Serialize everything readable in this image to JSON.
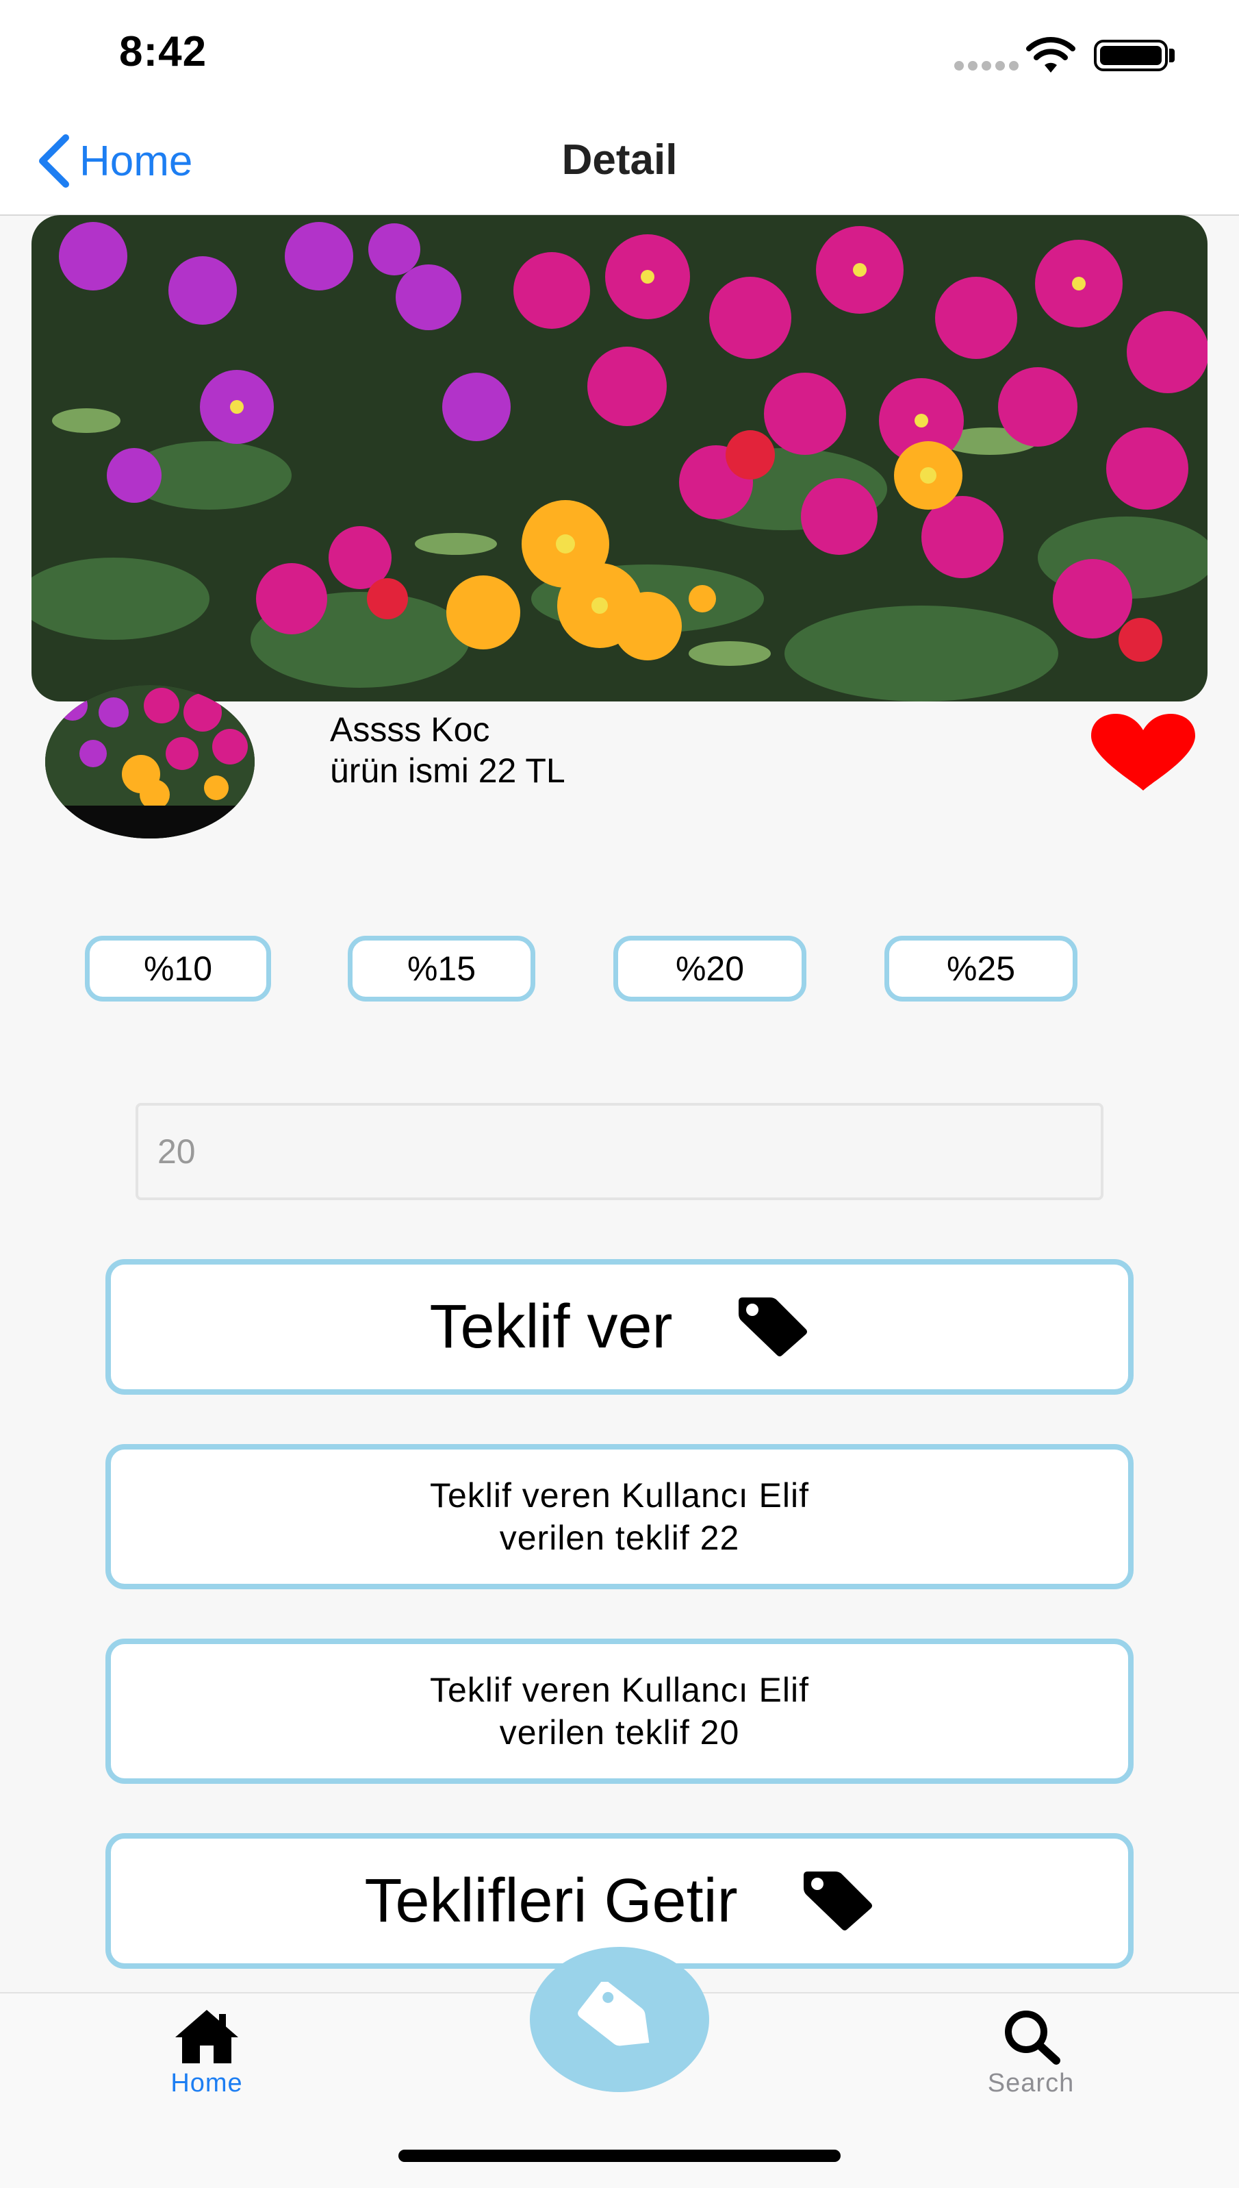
{
  "status_bar": {
    "time": "8:42"
  },
  "nav": {
    "back_label": "Home",
    "title": "Detail"
  },
  "profile": {
    "user_name": "Assss Koc",
    "product_info": "ürün ismi 22 TL"
  },
  "discounts": [
    "%10",
    "%15",
    "%20",
    "%25"
  ],
  "offer_input": {
    "value": "20"
  },
  "submit_button": {
    "label": "Teklif ver",
    "icon": "tag-icon"
  },
  "offers": [
    {
      "line1": "Teklif veren Kullancı Elif",
      "line2": "verilen teklif 22"
    },
    {
      "line1": "Teklif veren Kullancı Elif",
      "line2": "verilen teklif 20"
    }
  ],
  "fetch_button": {
    "label": "Teklifleri Getir",
    "icon": "tag-icon"
  },
  "tab_bar": {
    "home_label": "Home",
    "search_label": "Search",
    "center_icon": "tag-icon"
  },
  "colors": {
    "accent": "#1d7ef2",
    "border_blue": "#9ad3ea",
    "favorite": "#ff0000",
    "inactive_tab": "#8e8e93"
  }
}
